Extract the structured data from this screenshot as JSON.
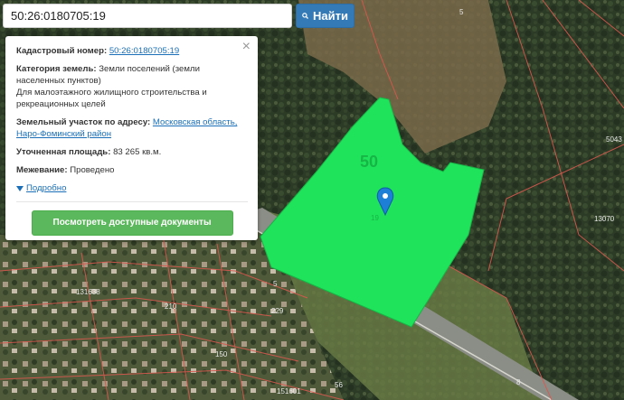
{
  "search": {
    "value": "50:26:0180705:19",
    "button_label": "Найти",
    "button_icon": "search-icon"
  },
  "info": {
    "cadastral_label": "Кадастровый номер:",
    "cadastral_value": "50:26:0180705:19",
    "category_label": "Категория земель:",
    "category_value_1": "Земли поселений (земли",
    "category_value_2": "населенных пунктов)",
    "category_value_3": "Для малоэтажного жилищного строительства и",
    "category_value_4": "рекреационных целей",
    "address_label": "Земельный участок по адресу:",
    "address_value_1": "Московская область,",
    "address_value_2": "Наро-Фоминский район",
    "area_label": "Уточненная площадь:",
    "area_value": "83 265 кв.м.",
    "survey_label": "Межевание:",
    "survey_value": "Проведено",
    "more_label": "Подробно",
    "docs_button": "Посмотреть доступные документы",
    "close_label": "×"
  },
  "map": {
    "parcel_label": "50",
    "parcel_number": "19",
    "parcel_color": "#1fe35a",
    "labels": [
      "5",
      "5043",
      "13070",
      "131638",
      "210",
      "5",
      "229",
      "151601",
      "56",
      "8",
      "150"
    ]
  }
}
